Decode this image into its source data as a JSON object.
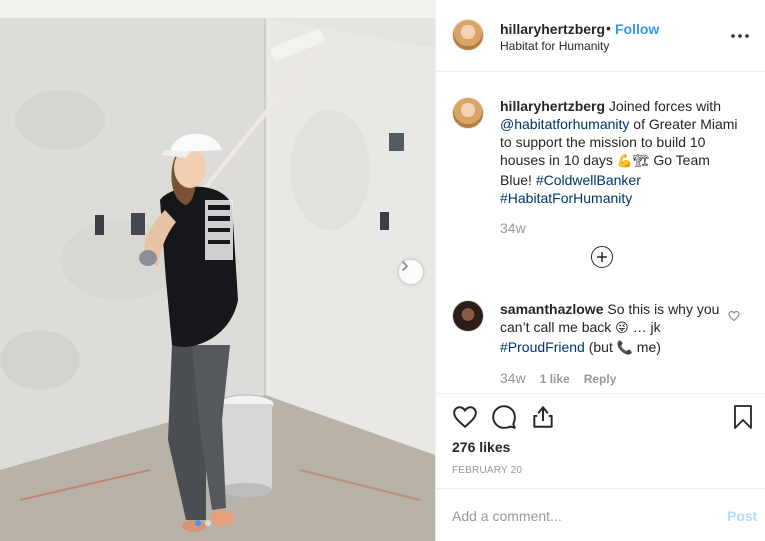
{
  "post": {
    "username": "hillaryhertzberg",
    "separator": "•",
    "follow_label": "Follow",
    "location": "Habitat for Humanity"
  },
  "caption": {
    "username": "hillaryhertzberg",
    "text_1": " Joined forces with ",
    "mention": "@habitatforhumanity",
    "text_2": " of Greater Miami to support the mission to build 10 houses in 10 days ",
    "emoji": "💪🏗",
    "text_3": " Go Team Blue! ",
    "hashtag_1": "#ColdwellBanker",
    "hashtag_2": "#HabitatForHumanity",
    "timestamp": "34w"
  },
  "comment": {
    "username": "samanthazlowe",
    "text_1": " So this is why you can’t call me back ",
    "emoji_1": "😜",
    "text_2": " … jk ",
    "hashtag": "#ProudFriend",
    "text_3": " (but ",
    "emoji_2": "📞",
    "text_4": " me)",
    "timestamp": "34w",
    "likes_label": "1 like",
    "reply_label": "Reply"
  },
  "likes": "276 likes",
  "date": "FEBRUARY 20",
  "add_comment": {
    "placeholder": "Add a comment...",
    "post_label": "Post"
  },
  "carousel": {
    "slide_count": 2,
    "active_index": 0
  },
  "colors": {
    "link_blue": "#3897f0",
    "hashtag_blue": "#003569",
    "muted": "#999999",
    "post_disabled": "#b2dffc"
  },
  "icons": [
    "more-options-icon",
    "plus-circle-icon",
    "heart-icon",
    "comment-icon",
    "share-icon",
    "bookmark-icon",
    "chevron-right-icon"
  ]
}
